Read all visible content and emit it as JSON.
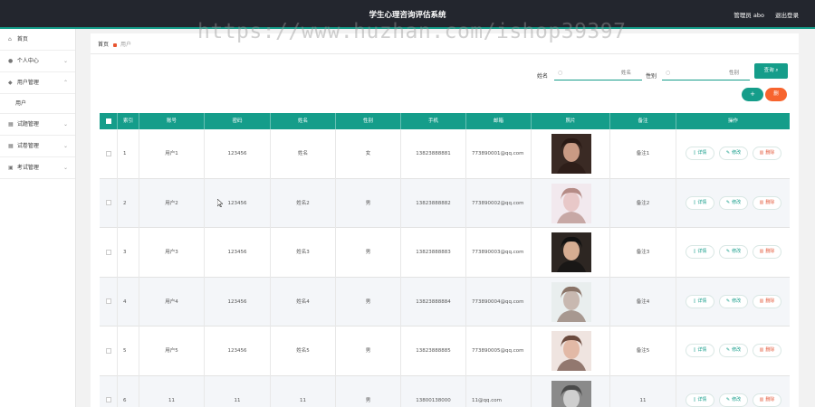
{
  "header": {
    "title": "学生心理咨询评估系统",
    "user_label": "管理员 abo",
    "logout_label": "退出登录"
  },
  "watermark": "https://www.huzhan.com/ishop39397",
  "sidebar": {
    "items": [
      {
        "label": "首页",
        "icon": "home-icon"
      },
      {
        "label": "个人中心",
        "icon": "user-icon"
      },
      {
        "label": "用户管理",
        "icon": "users-icon"
      },
      {
        "label": "用户",
        "icon": ""
      },
      {
        "label": "试题管理",
        "icon": "grid-icon"
      },
      {
        "label": "试卷管理",
        "icon": "grid-icon"
      },
      {
        "label": "考试管理",
        "icon": "exam-icon"
      }
    ]
  },
  "breadcrumb": {
    "home": "首页",
    "current": "用户"
  },
  "search": {
    "name_label": "姓名",
    "name_placeholder": "姓名",
    "gender_label": "性别",
    "gender_placeholder": "性别",
    "query_label": "查询"
  },
  "actions": {
    "add_label": "+",
    "delete_label": "删"
  },
  "table": {
    "columns": [
      "索引",
      "账号",
      "密码",
      "姓名",
      "性别",
      "手机",
      "邮箱",
      "照片",
      "备注",
      "操作"
    ],
    "rows": [
      {
        "index": "1",
        "account": "用户1",
        "password": "123456",
        "name": "姓名",
        "gender": "女",
        "phone": "13823888881",
        "email": "773890001@qq.com",
        "remark": "备注1"
      },
      {
        "index": "2",
        "account": "用户2",
        "password": "123456",
        "name": "姓名2",
        "gender": "男",
        "phone": "13823888882",
        "email": "773890002@qq.com",
        "remark": "备注2"
      },
      {
        "index": "3",
        "account": "用户3",
        "password": "123456",
        "name": "姓名3",
        "gender": "男",
        "phone": "13823888883",
        "email": "773890003@qq.com",
        "remark": "备注3"
      },
      {
        "index": "4",
        "account": "用户4",
        "password": "123456",
        "name": "姓名4",
        "gender": "男",
        "phone": "13823888884",
        "email": "773890004@qq.com",
        "remark": "备注4"
      },
      {
        "index": "5",
        "account": "用户5",
        "password": "123456",
        "name": "姓名5",
        "gender": "男",
        "phone": "13823888885",
        "email": "773890005@qq.com",
        "remark": "备注5"
      },
      {
        "index": "6",
        "account": "11",
        "password": "11",
        "name": "11",
        "gender": "男",
        "phone": "13800138000",
        "email": "11@qq.com",
        "remark": "11"
      }
    ],
    "ops": {
      "detail": "详情",
      "edit": "修改",
      "delete": "删除"
    }
  },
  "colors": {
    "accent": "#159d8a",
    "danger": "#f7642e",
    "topbar": "#23262e"
  }
}
